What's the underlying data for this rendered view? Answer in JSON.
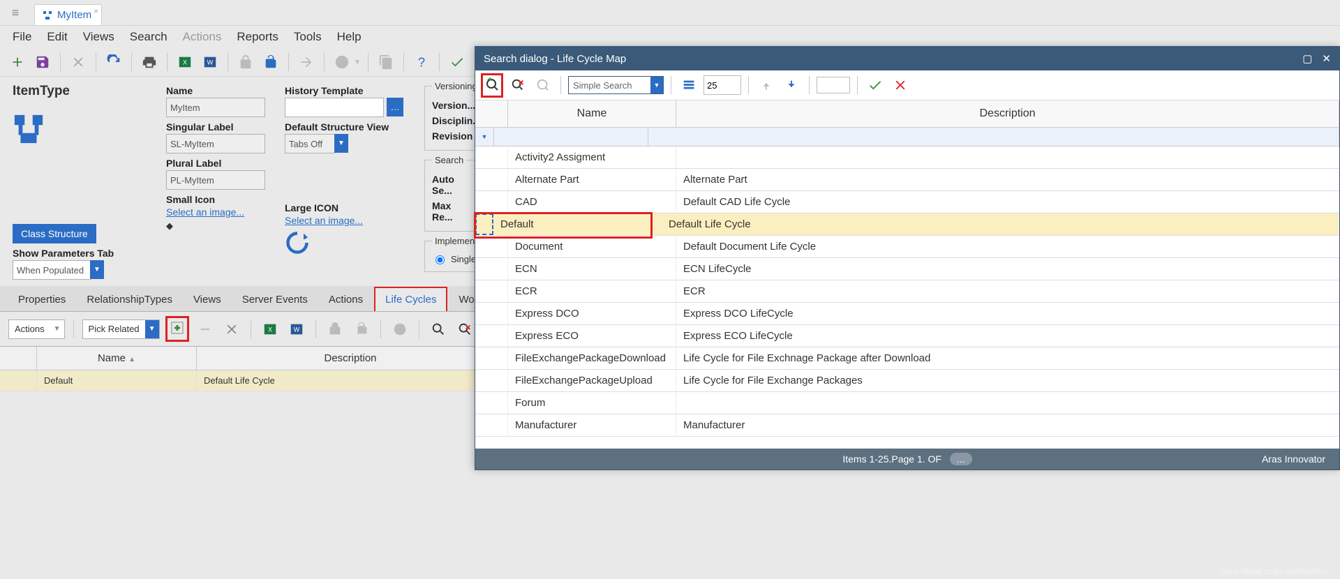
{
  "tab": {
    "label": "MyItem"
  },
  "menu": {
    "file": "File",
    "edit": "Edit",
    "views": "Views",
    "search": "Search",
    "actions": "Actions",
    "reports": "Reports",
    "tools": "Tools",
    "help": "Help"
  },
  "form": {
    "title": "ItemType",
    "name_lbl": "Name",
    "name_val": "MyItem",
    "singular_lbl": "Singular Label",
    "singular_val": "SL-MyItem",
    "plural_lbl": "Plural Label",
    "plural_val": "PL-MyItem",
    "small_lbl": "Small Icon",
    "small_link": "Select an image...",
    "large_lbl": "Large ICON",
    "large_link": "Select an image...",
    "hist_lbl": "History Template",
    "struct_lbl": "Default Structure View",
    "struct_val": "Tabs Off",
    "class_btn": "Class Structure",
    "showparam_lbl": "Show Parameters Tab",
    "showparam_val": "When Populated",
    "versioning": "Versioning",
    "versionable": "Version...",
    "discipline": "Disciplin...",
    "revisions": "Revision",
    "search_grp": "Search",
    "auto": "Auto Se...",
    "max": "Max Re...",
    "impl": "Implementa...",
    "single": "Single"
  },
  "tabs": {
    "properties": "Properties",
    "reltypes": "RelationshipTypes",
    "views": "Views",
    "server": "Server Events",
    "actions": "Actions",
    "lifecycles": "Life Cycles",
    "workflows": "Workflow"
  },
  "rel": {
    "actions": "Actions",
    "pick": "Pick Related",
    "col_name": "Name",
    "col_desc": "Description",
    "row_name": "Default",
    "row_desc": "Default Life Cycle"
  },
  "dlg": {
    "title": "Search dialog - Life Cycle Map",
    "simple": "Simple Search",
    "pagesize": "25",
    "col_name": "Name",
    "col_desc": "Description",
    "rows": [
      {
        "n": "Activity2 Assigment",
        "d": ""
      },
      {
        "n": "Alternate Part",
        "d": "Alternate Part"
      },
      {
        "n": "CAD",
        "d": "Default CAD Life Cycle"
      },
      {
        "n": "Default",
        "d": "Default Life Cycle"
      },
      {
        "n": "Document",
        "d": "Default Document Life Cycle"
      },
      {
        "n": "ECN",
        "d": "ECN LifeCycle"
      },
      {
        "n": "ECR",
        "d": "ECR"
      },
      {
        "n": "Express DCO",
        "d": "Express DCO LifeCycle"
      },
      {
        "n": "Express ECO",
        "d": "Express ECO LifeCycle"
      },
      {
        "n": "FileExchangePackageDownload",
        "d": "Life Cycle for File Exchnage Package after Download"
      },
      {
        "n": "FileExchangePackageUpload",
        "d": "Life Cycle for File Exchange Packages"
      },
      {
        "n": "Forum",
        "d": ""
      },
      {
        "n": "Manufacturer",
        "d": "Manufacturer"
      }
    ],
    "selected_index": 3,
    "status": "Items 1-25.Page 1. OF",
    "brand": "Aras Innovator",
    "more": "..."
  },
  "watermark": "https://blog.csdn.net/hwytree"
}
